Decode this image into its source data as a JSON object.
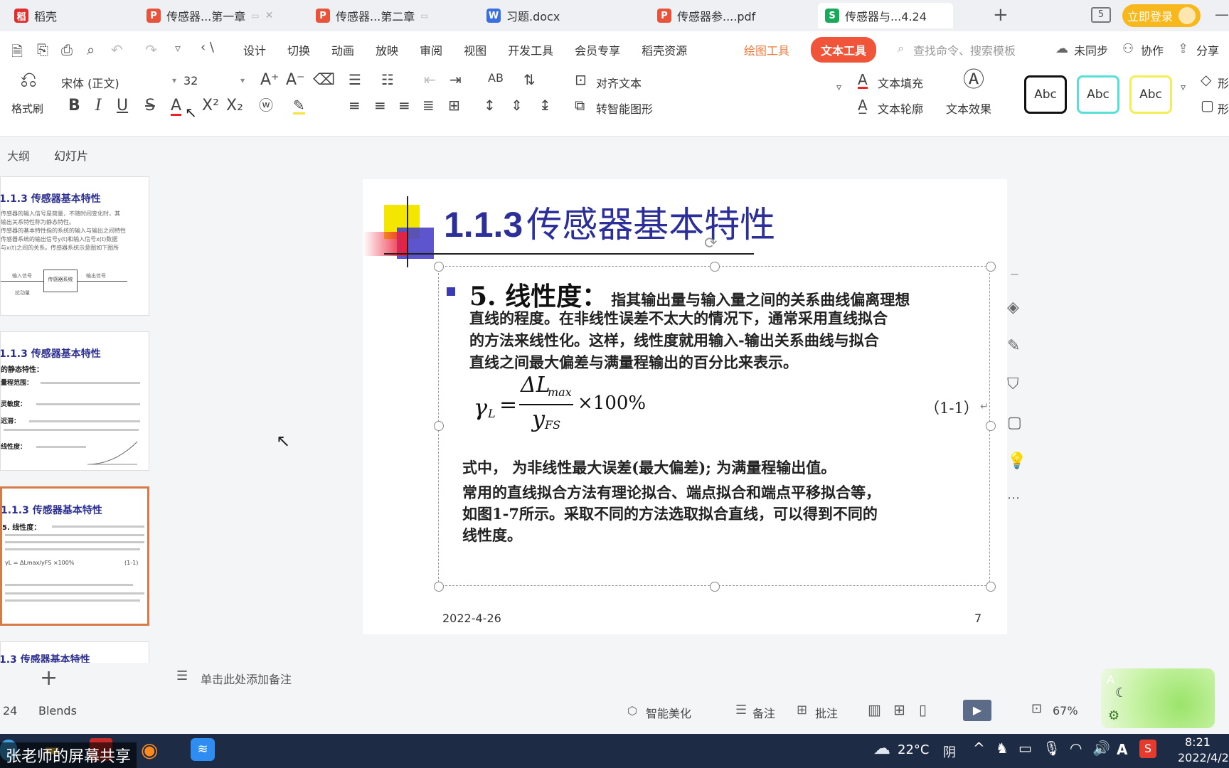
{
  "tabs": [
    {
      "label": "稻壳",
      "icon": "docer-icon",
      "color": "#e02d2d"
    },
    {
      "label": "传感器...第一章",
      "icon": "ppt-icon",
      "color": "#e8533c"
    },
    {
      "label": "传感器...第二章",
      "icon": "ppt-icon",
      "color": "#e8533c"
    },
    {
      "label": "习题.docx",
      "icon": "word-icon",
      "color": "#3b6fe0"
    },
    {
      "label": "传感器参....pdf",
      "icon": "pdf-icon",
      "color": "#e8533c"
    },
    {
      "label": "传感器与...4.24",
      "icon": "sheet-icon",
      "color": "#1aa85c"
    }
  ],
  "tabbar": {
    "badge": "5",
    "login": "立即登录"
  },
  "menu": [
    "设计",
    "切换",
    "动画",
    "放映",
    "审阅",
    "视图",
    "开发工具",
    "会员专享",
    "稻壳资源"
  ],
  "menu_special": {
    "draw": "绘图工具",
    "text": "文本工具",
    "search": "查找命令、搜索模板",
    "sync": "未同步",
    "collab": "协作",
    "share": "分享"
  },
  "ribbon": {
    "format_painter": "格式刷",
    "font": "宋体 (正文)",
    "size": "32",
    "align_text": "对齐文本",
    "smart_shape": "转智能图形",
    "text_fill": "文本填充",
    "text_outline": "文本轮廓",
    "text_effect": "文本效果",
    "abc": "Abc",
    "shape_cut": "形"
  },
  "leftpanel": {
    "tab1": "大纲",
    "tab2": "幻灯片",
    "thumb_title": "1.1.3 传感器基本特性",
    "t1": [
      "传感器的输入信号是简量，不随时间变化时，其",
      "输出关系特性称为静态特性。",
      "传感器的基本特性指的系统的输入与输出之间特性",
      "传感器系统的输出信号y(t)和输入信号x(t)数据",
      "与x(t)之间的关系。传感器系统示意图如下图所"
    ],
    "t1_boxes": {
      "in": "输入信号",
      "sys": "传感器系统",
      "out": "输出信号",
      "noise": "扰动量"
    },
    "t2": {
      "h": "的静态特性：",
      "a": "量程范围：",
      "b": "灵敏度：",
      "c": "迟滞：",
      "d": "线性度："
    },
    "t3": {
      "h": "5. 线性度：",
      "formula": "γL = ΔLmax/yFS ×100%",
      "eq": "(1-1)"
    },
    "t4": "1.3 传感器基本特性"
  },
  "slide": {
    "title_num": "1.1.3",
    "title_text": "传感器基本特性",
    "bullet_head": "5. 线性度：",
    "para1_first": "指其输出量与输入量之间的关系曲线偏离理想",
    "para1_lines": [
      "直线的程度。在非线性误差不太大的情况下，通常采用直线拟合",
      "的方法来线性化。这样，线性度就用输入-输出关系曲线与拟合",
      "直线之间最大偏差与满量程输出的百分比来表示。"
    ],
    "formula": {
      "lhs": "γ",
      "lhs_sub": "L",
      "num": "ΔL",
      "num_sub": "max",
      "den": "y",
      "den_sub": "FS",
      "times": "×100%",
      "eq_no": "（1-1）",
      "ret": "↵"
    },
    "note": "式中，  为非线性最大误差(最大偏差); 为满量程输出值。",
    "para2": [
      "常用的直线拟合方法有理论拟合、端点拟合和端点平移拟合等，",
      " 如图1-7所示。采取不同的方法选取拟合直线，可以得到不同的",
      " 线性度。"
    ],
    "para2_bold": "1-7",
    "date": "2022-4-26",
    "page": "7"
  },
  "statusbar": {
    "notes": "单击此处添加备注",
    "slide_no": "24",
    "theme": "Blends",
    "beautify": "智能美化",
    "remarks": "备注",
    "comment": "批注",
    "zoom": "67%"
  },
  "taskbar": {
    "share": "张老师的屏幕共享",
    "temp": "22°C",
    "weather": "阴",
    "time": "8:21",
    "date": "2022/4/2",
    "ime": "A"
  }
}
